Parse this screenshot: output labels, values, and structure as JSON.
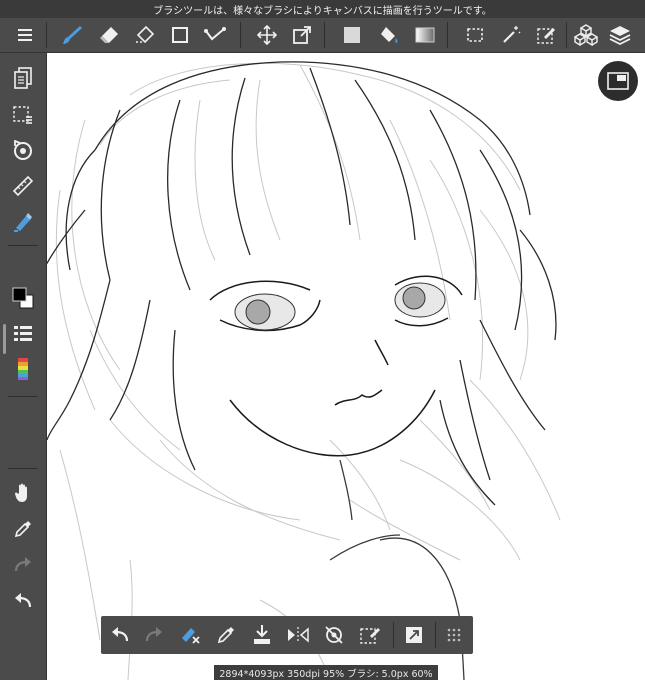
{
  "status_bar": {
    "tooltip": "ブラシツールは、様々なブラシによりキャンバスに描画を行うツールです。"
  },
  "top_toolbar": {
    "items": [
      {
        "name": "menu-icon",
        "active": false
      },
      {
        "name": "brush-icon",
        "active": true
      },
      {
        "name": "eraser-icon",
        "active": false
      },
      {
        "name": "blur-eraser-icon",
        "active": false
      },
      {
        "name": "rectangle-icon",
        "active": false
      },
      {
        "name": "correction-icon",
        "active": false
      },
      {
        "name": "move-icon",
        "active": false
      },
      {
        "name": "transform-icon",
        "active": false
      },
      {
        "name": "fill-rect-icon",
        "active": false
      },
      {
        "name": "bucket-icon",
        "active": false
      },
      {
        "name": "gradient-icon",
        "active": false
      },
      {
        "name": "selection-icon",
        "active": false
      },
      {
        "name": "magic-wand-icon",
        "active": false
      },
      {
        "name": "select-pen-icon",
        "active": false
      },
      {
        "name": "material-icon",
        "active": false
      },
      {
        "name": "layers-icon",
        "active": false
      }
    ]
  },
  "left_toolbar": {
    "items": [
      "pages-icon",
      "selection-layer-icon",
      "rotate-view-icon",
      "ruler-icon",
      "pen-icon",
      "color-icon",
      "brush-list-icon",
      "palette-icon",
      "hand-icon",
      "eyedropper-icon",
      "redo-icon",
      "undo-icon"
    ],
    "main_color": "#000000",
    "sub_color": "#ffffff"
  },
  "command_bar": {
    "items": [
      "undo-icon",
      "redo-icon",
      "deselect-icon",
      "eyedropper-icon",
      "import-icon",
      "flip-horizontal-icon",
      "reset-rotation-icon",
      "clear-selection-icon",
      "quick-edit-icon",
      "more-icon"
    ]
  },
  "info_bar": {
    "text": "2894*4093px 350dpi 95% ブラシ: 5.0px 60%"
  },
  "colors": {
    "toolbar_bg": "#4b4b4b",
    "status_bg": "#3a3a3a",
    "accent_blue": "#4d9de0",
    "icon_white": "#f0f0f0"
  }
}
